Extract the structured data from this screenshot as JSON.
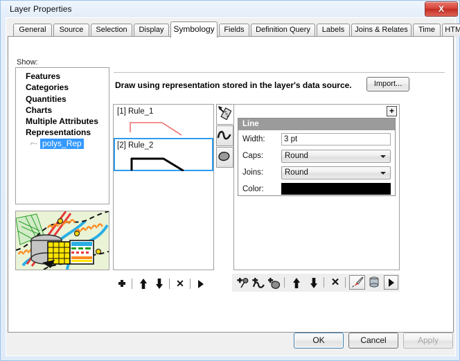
{
  "window": {
    "title": "Layer Properties",
    "close_label": "X",
    "close_icon": "close-icon"
  },
  "tabs": [
    {
      "label": "General",
      "active": false
    },
    {
      "label": "Source",
      "active": false
    },
    {
      "label": "Selection",
      "active": false
    },
    {
      "label": "Display",
      "active": false
    },
    {
      "label": "Symbology",
      "active": true
    },
    {
      "label": "Fields",
      "active": false
    },
    {
      "label": "Definition Query",
      "active": false
    },
    {
      "label": "Labels",
      "active": false
    },
    {
      "label": "Joins & Relates",
      "active": false
    },
    {
      "label": "Time",
      "active": false
    },
    {
      "label": "HTML Popup",
      "active": false
    }
  ],
  "show": {
    "label": "Show:",
    "items": [
      {
        "label": "Features",
        "selected": false
      },
      {
        "label": "Categories",
        "selected": false
      },
      {
        "label": "Quantities",
        "selected": false
      },
      {
        "label": "Charts",
        "selected": false
      },
      {
        "label": "Multiple Attributes",
        "selected": false
      },
      {
        "label": "Representations",
        "selected": false
      }
    ],
    "child": {
      "label": "polys_Rep",
      "selected": true
    }
  },
  "preview": {
    "name": "symbol-preview-thumbnail"
  },
  "description": {
    "text": "Draw using representation stored in the layer's data source.",
    "import_label": "Import..."
  },
  "rules": [
    {
      "index_label": "[1]",
      "name": "Rule_1",
      "label": "[1] Rule_1",
      "color": "#ef6f6f",
      "selected": false
    },
    {
      "index_label": "[2]",
      "name": "Rule_2",
      "label": "[2] Rule_2",
      "color": "#000000",
      "selected": true
    }
  ],
  "rule_toolbar": {
    "add_label": "+",
    "move_up_label": "↑",
    "move_down_label": "↓",
    "delete_label": "✕",
    "menu_label": "▶",
    "icons": [
      "add-rule-icon",
      "move-up-icon",
      "move-down-icon",
      "delete-rule-icon",
      "rule-options-icon"
    ]
  },
  "vertical_tabs": [
    {
      "icon": "geometry-effects-icon",
      "active": true
    },
    {
      "icon": "line-symbol-layer-icon",
      "active": false
    },
    {
      "icon": "fill-symbol-layer-icon",
      "active": false
    }
  ],
  "properties": {
    "add_label": "+",
    "group_title": "Line",
    "fields": [
      {
        "label": "Width:",
        "value": "3 pt",
        "type": "text"
      },
      {
        "label": "Caps:",
        "value": "Round",
        "type": "combo"
      },
      {
        "label": "Joins:",
        "value": "Round",
        "type": "combo"
      },
      {
        "label": "Color:",
        "value": "#000000",
        "type": "color"
      }
    ]
  },
  "layer_toolbar": {
    "icons": [
      "add-marker-layer-icon",
      "add-line-layer-icon",
      "add-fill-layer-icon",
      "move-up-icon",
      "move-down-icon",
      "delete-layer-icon",
      "toggle-drawing-icon",
      "toggle-geometry-icon",
      "layer-options-icon"
    ],
    "move_up_label": "↑",
    "move_down_label": "↓",
    "delete_label": "✕",
    "menu_label": "▶"
  },
  "footer": {
    "ok_label": "OK",
    "cancel_label": "Cancel",
    "apply_label": "Apply",
    "apply_disabled": true
  },
  "colors": {
    "accent": "#3399ff",
    "selection_border": "#2e9bef",
    "rule1_line": "#ef6f6f",
    "rule2_line": "#000000",
    "group_header": "#9b9b9b",
    "swatch": "#000000"
  }
}
